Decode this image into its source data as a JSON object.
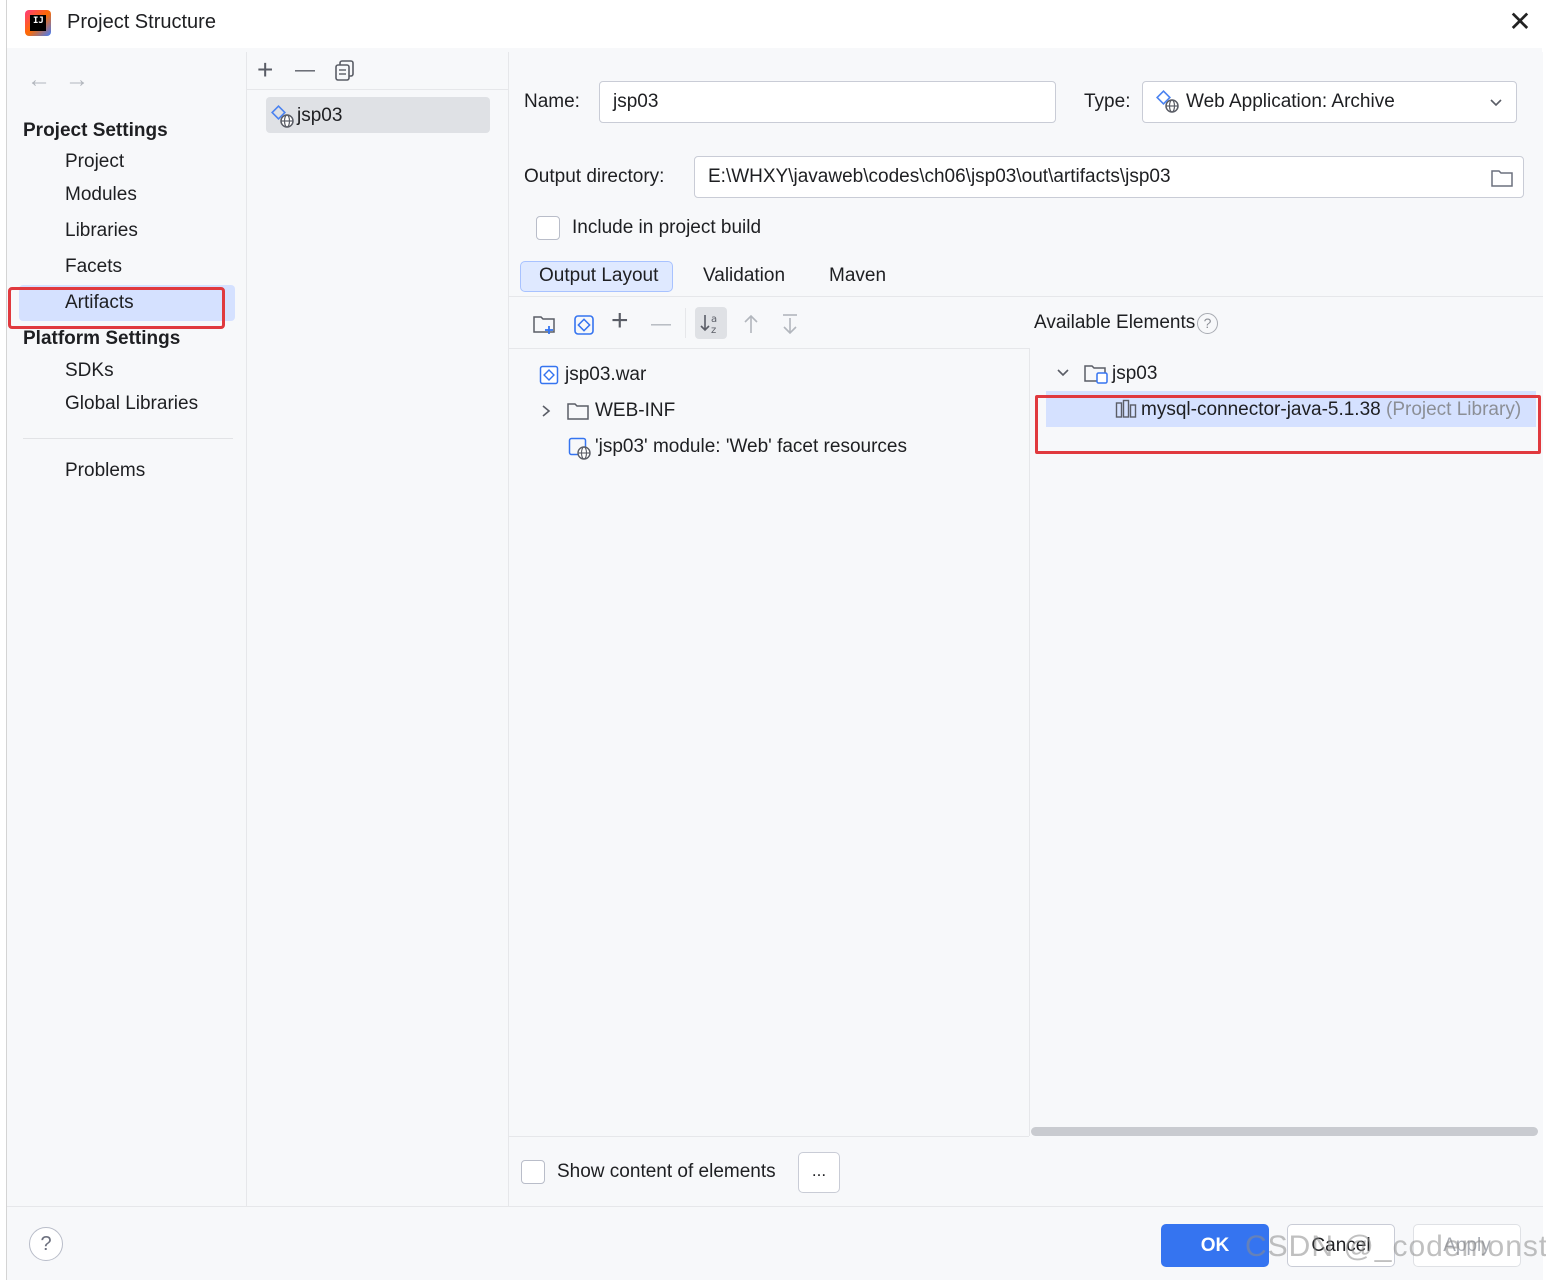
{
  "window": {
    "title": "Project Structure",
    "close_symbol": "✕",
    "app_icon_text": "IJ"
  },
  "nav": {
    "back_arrow": "←",
    "forward_arrow": "→",
    "project_settings_heading": "Project Settings",
    "project_settings_items": [
      "Project",
      "Modules",
      "Libraries",
      "Facets",
      "Artifacts"
    ],
    "platform_settings_heading": "Platform Settings",
    "platform_settings_items": [
      "SDKs",
      "Global Libraries"
    ],
    "problems": "Problems",
    "selected": "Artifacts"
  },
  "artifacts_list": {
    "toolbar": {
      "add": "+",
      "remove": "—",
      "copy": "copy-icon"
    },
    "items": [
      "jsp03"
    ]
  },
  "artifact": {
    "name_label": "Name:",
    "name_value": "jsp03",
    "type_label": "Type:",
    "type_value": "Web Application: Archive",
    "output_dir_label": "Output directory:",
    "output_dir_value": "E:\\WHXY\\javaweb\\codes\\ch06\\jsp03\\out\\artifacts\\jsp03",
    "include_in_build_label": "Include in project build",
    "include_in_build_checked": false
  },
  "tabs": [
    "Output Layout",
    "Validation",
    "Maven"
  ],
  "active_tab": "Output Layout",
  "output_layout": {
    "tree": [
      {
        "label": "jsp03.war",
        "icon": "archive-icon"
      },
      {
        "label": "WEB-INF",
        "icon": "folder-icon",
        "expandable": true
      },
      {
        "label": "'jsp03' module: 'Web' facet resources",
        "icon": "web-facet-icon"
      }
    ]
  },
  "available_elements": {
    "heading": "Available Elements",
    "help_symbol": "?",
    "tree": [
      {
        "label": "jsp03",
        "icon": "module-folder-icon",
        "expanded": true
      },
      {
        "label": "mysql-connector-java-5.1.38",
        "suffix": "(Project Library)",
        "icon": "library-icon",
        "selected": true
      }
    ]
  },
  "show_content_label": "Show content of elements",
  "show_content_checked": false,
  "ellipsis_button": "...",
  "footer": {
    "help": "?",
    "ok": "OK",
    "cancel": "Cancel",
    "apply": "Apply",
    "watermark": "CSDN @_codemonster"
  },
  "colors": {
    "accent": "#3574f0",
    "selection": "#d5e1ff",
    "highlight_box": "#e0393e"
  }
}
